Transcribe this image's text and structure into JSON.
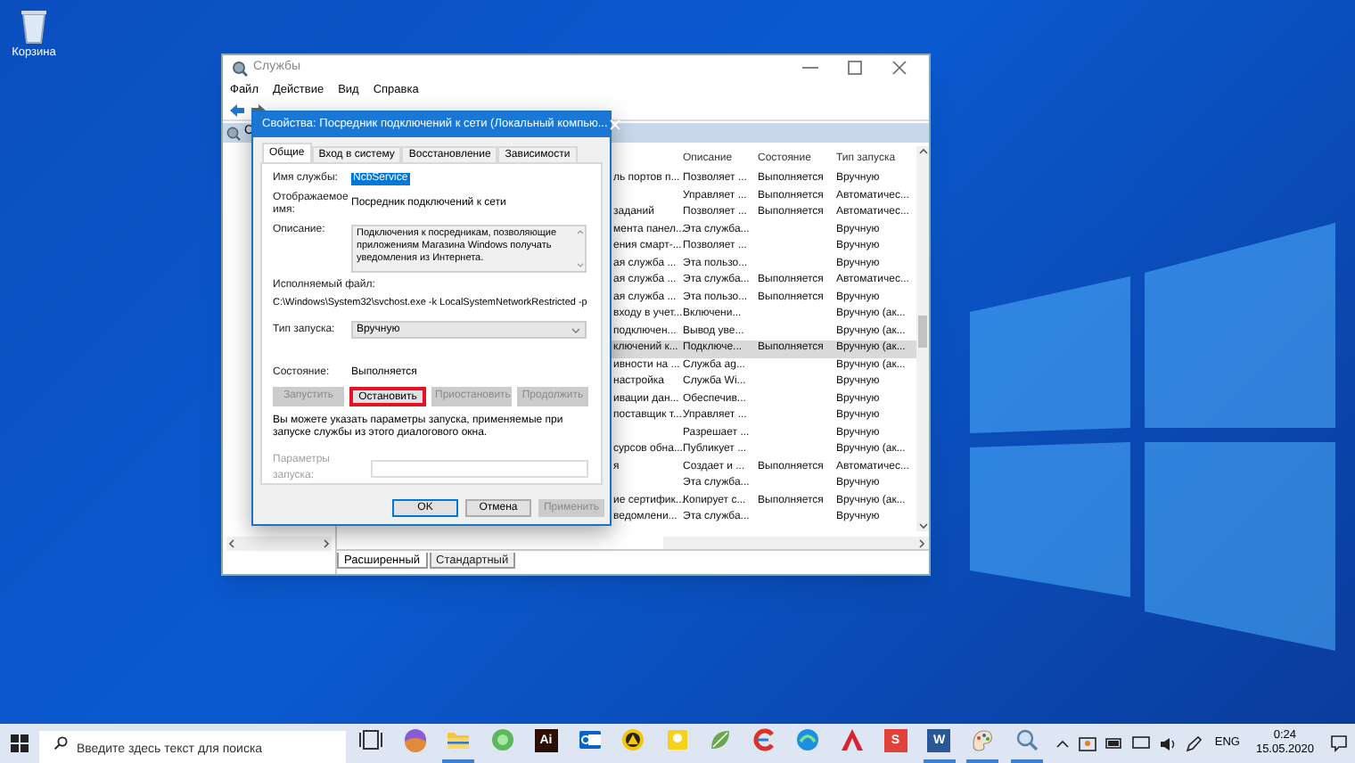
{
  "desktop": {
    "icons": [
      {
        "label": "Корзина"
      }
    ]
  },
  "services_window": {
    "title": "Службы",
    "menu": [
      "Файл",
      "Действие",
      "Вид",
      "Справка"
    ],
    "tree_header": "С",
    "columns": [
      "Описание",
      "Состояние",
      "Тип запуска"
    ],
    "rows": [
      {
        "name": "ль портов п...",
        "description": "Позволяет ...",
        "status": "Выполняется",
        "startup": "Вручную",
        "selected": false
      },
      {
        "description": "Управляет ...",
        "status": "Выполняется",
        "startup": "Автоматичес...",
        "selected": false
      },
      {
        "name": "заданий",
        "description": "Позволяет ...",
        "status": "Выполняется",
        "startup": "Автоматичес...",
        "selected": false
      },
      {
        "name": "мента панел...",
        "description": "Эта служба...",
        "startup": "Вручную",
        "selected": false
      },
      {
        "name": "ения смарт-...",
        "description": "Позволяет ...",
        "startup": "Вручную",
        "selected": false
      },
      {
        "name": "ая служба ...",
        "description": "Эта пользо...",
        "startup": "Вручную",
        "selected": false
      },
      {
        "name": "ая служба ...",
        "description": "Эта служба...",
        "status": "Выполняется",
        "startup": "Автоматичес...",
        "selected": false
      },
      {
        "name": "ая служба ...",
        "description": "Эта пользо...",
        "status": "Выполняется",
        "startup": "Вручную",
        "selected": false
      },
      {
        "name": "входу в учет...",
        "description": "Включени...",
        "startup": "Вручную (ак...",
        "selected": false
      },
      {
        "name": "подключен...",
        "description": "Вывод уве...",
        "startup": "Вручную (ак...",
        "selected": false
      },
      {
        "name": "ключений к...",
        "description": "Подключе...",
        "status": "Выполняется",
        "startup": "Вручную (ак...",
        "selected": true
      },
      {
        "name": "ивности на ...",
        "description": "Служба ag...",
        "startup": "Вручную (ак...",
        "selected": false
      },
      {
        "name": "настройка",
        "description": "Служба Wi...",
        "startup": "Вручную",
        "selected": false
      },
      {
        "name": "ивации дан...",
        "description": "Обеспечив...",
        "startup": "Вручную",
        "selected": false
      },
      {
        "name": "поставщик т...",
        "description": "Управляет ...",
        "startup": "Вручную",
        "selected": false
      },
      {
        "description": "Разрешает ...",
        "startup": "Вручную",
        "selected": false
      },
      {
        "name": "сурсов обна...",
        "description": "Публикует ...",
        "startup": "Вручную (ак...",
        "selected": false
      },
      {
        "name": "я",
        "description": "Создает и ...",
        "status": "Выполняется",
        "startup": "Автоматичес...",
        "selected": false
      },
      {
        "description": "Эта служба...",
        "startup": "Вручную",
        "selected": false
      },
      {
        "name": "ие сертифик...",
        "description": "Копирует с...",
        "status": "Выполняется",
        "startup": "Вручную (ак...",
        "selected": false
      },
      {
        "name": "ведомлени...",
        "description": "Эта служба...",
        "startup": "Вручную",
        "selected": false
      }
    ],
    "view_tabs": [
      {
        "label": "Расширенный",
        "selected": true
      },
      {
        "label": "Стандартный",
        "selected": false
      }
    ]
  },
  "dialog": {
    "title": "Свойства: Посредник подключений к сети (Локальный компью...",
    "tabs": [
      {
        "label": "Общие",
        "selected": true
      },
      {
        "label": "Вход в систему",
        "selected": false
      },
      {
        "label": "Восстановление",
        "selected": false
      },
      {
        "label": "Зависимости",
        "selected": false
      }
    ],
    "fields": [
      {
        "kind": "selected",
        "label": "Имя службы:",
        "value": "NcbService"
      },
      {
        "kind": "text",
        "label": "Отображаемое имя:",
        "value": "Посредник подключений к сети"
      },
      {
        "kind": "textarea",
        "label": "Описание:",
        "value": "Подключения к посредникам, позволяющие приложениям Магазина Windows получать уведомления из Интернета."
      }
    ],
    "executable": {
      "label": "Исполняемый файл:",
      "path": "C:\\Windows\\System32\\svchost.exe -k LocalSystemNetworkRestricted -p"
    },
    "startup_type": {
      "label": "Тип запуска:",
      "value": "Вручную"
    },
    "status": {
      "label": "Состояние:",
      "value": "Выполняется"
    },
    "service_buttons": [
      {
        "label": "Запустить",
        "disabled": true,
        "highlighted": false
      },
      {
        "label": "Остановить",
        "disabled": false,
        "highlighted": true
      },
      {
        "label": "Приостановить",
        "disabled": true,
        "highlighted": false
      },
      {
        "label": "Продолжить",
        "disabled": true,
        "highlighted": false
      }
    ],
    "note": "Вы можете указать параметры запуска, применяемые при запуске службы из этого диалогового окна.",
    "start_params": {
      "label": "Параметры запуска:",
      "disabled": true
    },
    "buttons": [
      {
        "label": "OK",
        "default": true,
        "disabled": false
      },
      {
        "label": "Отмена",
        "default": false,
        "disabled": false
      },
      {
        "label": "Применить",
        "default": false,
        "disabled": true
      }
    ]
  },
  "taskbar": {
    "search_placeholder": "Введите здесь текст для поиска",
    "apps": [
      {
        "kind": "taskview",
        "running": false
      },
      {
        "kind": "ball",
        "running": false
      },
      {
        "kind": "folder",
        "running": true
      },
      {
        "kind": "globe",
        "running": false
      },
      {
        "kind": "tile",
        "glyph": "Ai",
        "color": "#2b0f02",
        "running": false
      },
      {
        "kind": "mail",
        "running": false
      },
      {
        "kind": "ring",
        "running": false
      },
      {
        "kind": "note",
        "running": false
      },
      {
        "kind": "leaf",
        "running": false
      },
      {
        "kind": "swirl",
        "running": false
      },
      {
        "kind": "wave",
        "running": false
      },
      {
        "kind": "triangle",
        "running": false
      },
      {
        "kind": "tile",
        "glyph": "S",
        "color": "#e0413b",
        "running": false
      },
      {
        "kind": "tile",
        "glyph": "W",
        "color": "#2b5797",
        "running": true
      },
      {
        "kind": "palette",
        "running": true
      },
      {
        "kind": "magnifier",
        "running": true
      }
    ],
    "language": "ENG",
    "time": "0:24",
    "date": "15.05.2020"
  }
}
